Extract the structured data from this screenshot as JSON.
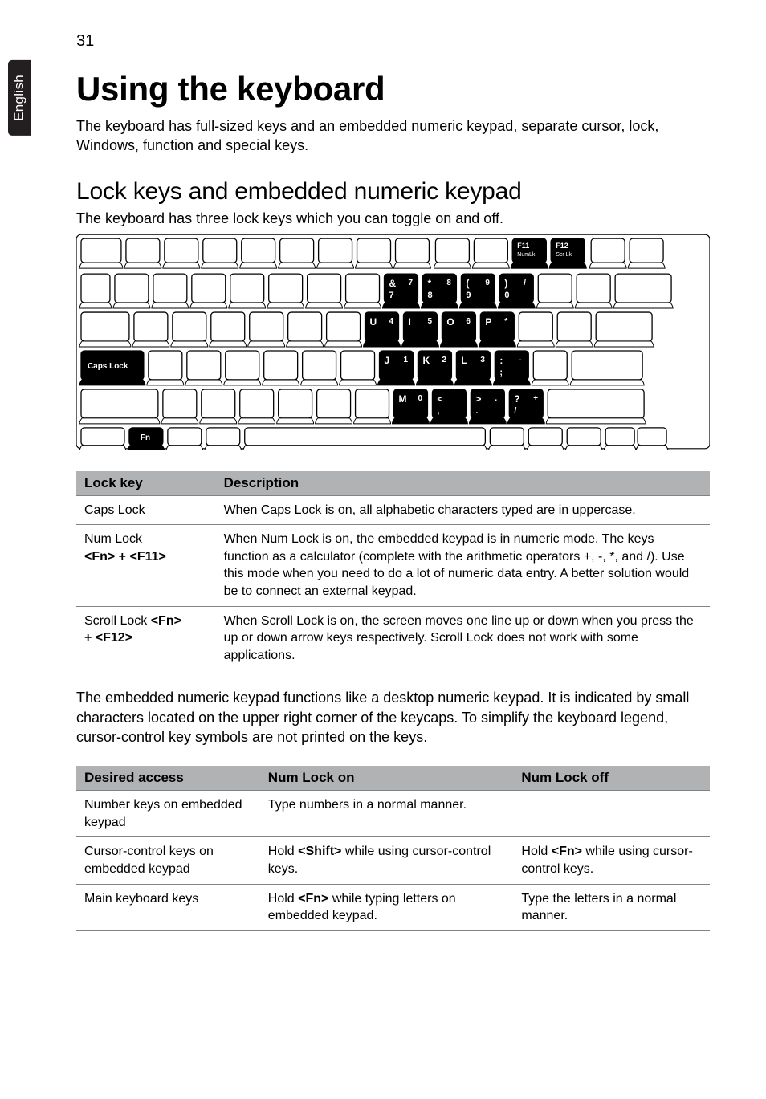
{
  "page_number": "31",
  "language_tab": "English",
  "title": "Using the keyboard",
  "intro": "The keyboard has full-sized keys and an embedded numeric keypad, separate cursor, lock, Windows, function and special keys.",
  "h2": "Lock keys and embedded numeric keypad",
  "h2_sub": "The keyboard has three lock keys which you can toggle on and off.",
  "keyboard_labels": {
    "f11_top": "F11",
    "f11_sub": "NumLk",
    "f12_top": "F12",
    "f12_sub": "Scr Lk",
    "caps": "Caps Lock",
    "fn": "Fn",
    "row1": [
      {
        "main": "&",
        "sub": "7",
        "alt": "7"
      },
      {
        "main": "*",
        "sub": "8",
        "alt": "8"
      },
      {
        "main": "(",
        "sub": "9",
        "alt": "9"
      },
      {
        "main": ")",
        "sub": "0",
        "alt": "/"
      }
    ],
    "row2": [
      {
        "main": "U",
        "alt": "4"
      },
      {
        "main": "I",
        "alt": "5"
      },
      {
        "main": "O",
        "alt": "6"
      },
      {
        "main": "P",
        "alt": "*"
      }
    ],
    "row3": [
      {
        "main": "J",
        "alt": "1"
      },
      {
        "main": "K",
        "alt": "2"
      },
      {
        "main": "L",
        "alt": "3"
      },
      {
        "main": ":",
        "sub": ";",
        "alt": "-"
      }
    ],
    "row4": [
      {
        "main": "M",
        "alt": "0"
      },
      {
        "main": "<",
        "sub": ",",
        "alt": ""
      },
      {
        "main": ">",
        "sub": ".",
        "alt": "."
      },
      {
        "main": "?",
        "sub": "/",
        "alt": "+"
      }
    ]
  },
  "lock_table": {
    "headers": [
      "Lock key",
      "Description"
    ],
    "rows": [
      {
        "k": "Caps Lock",
        "d": "When Caps Lock is on, all alphabetic characters typed are in uppercase."
      },
      {
        "k_html": "Num Lock <br><b>&lt;Fn&gt; + &lt;F11&gt;</b>",
        "d": "When Num Lock is on, the embedded keypad is in numeric mode. The keys function as a calculator (complete with the arithmetic operators +, -, *, and /). Use this mode when you need to do a lot of numeric data entry. A better solution would be to connect an external keypad."
      },
      {
        "k_html": "Scroll Lock <b>&lt;Fn&gt;</b> <br><b>+ &lt;F12&gt;</b>",
        "d": "When Scroll Lock is on, the screen moves one line up or down when you press the up or down arrow keys respectively. Scroll Lock does not work with some applications."
      }
    ]
  },
  "para2": "The embedded numeric keypad functions like a desktop numeric keypad. It is indicated by small characters located on the upper right corner of the keycaps. To simplify the keyboard legend, cursor-control key symbols are not printed on the keys.",
  "access_table": {
    "headers": [
      "Desired access",
      "Num Lock on",
      "Num Lock off"
    ],
    "rows": [
      {
        "c1": "Number keys on embedded keypad",
        "c2": "Type numbers in a normal manner.",
        "c3": ""
      },
      {
        "c1": "Cursor-control keys on embedded keypad",
        "c2_html": "Hold <b>&lt;Shift&gt;</b> while using cursor-control keys.",
        "c3_html": "Hold <b>&lt;Fn&gt;</b> while using cursor-control keys."
      },
      {
        "c1": "Main keyboard keys",
        "c2_html": "Hold <b>&lt;Fn&gt;</b> while typing letters on embedded keypad.",
        "c3": "Type the letters in a normal manner."
      }
    ]
  }
}
